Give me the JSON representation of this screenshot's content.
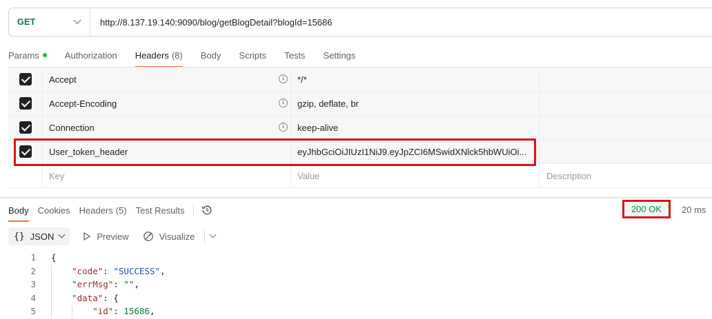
{
  "request": {
    "method": "GET",
    "url": "http://8.137.19.140:9090/blog/getBlogDetail?blogId=15686"
  },
  "request_tabs": [
    {
      "label": "Params",
      "has_dot": true,
      "count": ""
    },
    {
      "label": "Authorization",
      "has_dot": false,
      "count": ""
    },
    {
      "label": "Headers",
      "has_dot": false,
      "count": "(8)"
    },
    {
      "label": "Body",
      "has_dot": false,
      "count": ""
    },
    {
      "label": "Scripts",
      "has_dot": false,
      "count": ""
    },
    {
      "label": "Tests",
      "has_dot": false,
      "count": ""
    },
    {
      "label": "Settings",
      "has_dot": false,
      "count": ""
    }
  ],
  "headers": [
    {
      "key": "Accept",
      "value": "*/*",
      "checked": true,
      "info": true
    },
    {
      "key": "Accept-Encoding",
      "value": "gzip, deflate, br",
      "checked": true,
      "info": true
    },
    {
      "key": "Connection",
      "value": "keep-alive",
      "checked": true,
      "info": true
    },
    {
      "key": "User_token_header",
      "value": "eyJhbGciOiJIUzI1NiJ9.eyJpZCI6MSwidXNlck5hbWUiOi...",
      "checked": true,
      "info": false
    }
  ],
  "headers_placeholder": {
    "key": "Key",
    "value": "Value",
    "description": "Description"
  },
  "response_tabs": [
    {
      "label": "Body",
      "count": ""
    },
    {
      "label": "Cookies",
      "count": ""
    },
    {
      "label": "Headers",
      "count": "(5)"
    },
    {
      "label": "Test Results",
      "count": ""
    }
  ],
  "status": {
    "text": "200 OK",
    "time": "20 ms",
    "color": "#0b8a45"
  },
  "toolbar": {
    "format": "JSON",
    "preview": "Preview",
    "visualize": "Visualize"
  },
  "code_lines": [
    {
      "n": "1",
      "tokens": [
        {
          "t": "{",
          "c": "p"
        }
      ]
    },
    {
      "n": "2",
      "tokens": [
        {
          "t": "    ",
          "c": "p"
        },
        {
          "t": "\"code\"",
          "c": "k"
        },
        {
          "t": ": ",
          "c": "p"
        },
        {
          "t": "\"SUCCESS\"",
          "c": "s"
        },
        {
          "t": ",",
          "c": "p"
        }
      ]
    },
    {
      "n": "3",
      "tokens": [
        {
          "t": "    ",
          "c": "p"
        },
        {
          "t": "\"errMsg\"",
          "c": "k"
        },
        {
          "t": ": ",
          "c": "p"
        },
        {
          "t": "\"\"",
          "c": "s"
        },
        {
          "t": ",",
          "c": "p"
        }
      ]
    },
    {
      "n": "4",
      "tokens": [
        {
          "t": "    ",
          "c": "p"
        },
        {
          "t": "\"data\"",
          "c": "k"
        },
        {
          "t": ": {",
          "c": "p"
        }
      ]
    },
    {
      "n": "5",
      "tokens": [
        {
          "t": "        ",
          "c": "p"
        },
        {
          "t": "\"id\"",
          "c": "k"
        },
        {
          "t": ": ",
          "c": "p"
        },
        {
          "t": "15686",
          "c": "n"
        },
        {
          "t": ",",
          "c": "p"
        }
      ]
    }
  ],
  "colors": {
    "accent": "#ff6c37",
    "method": "#0b7a3e",
    "highlight_border": "#e0101b"
  }
}
